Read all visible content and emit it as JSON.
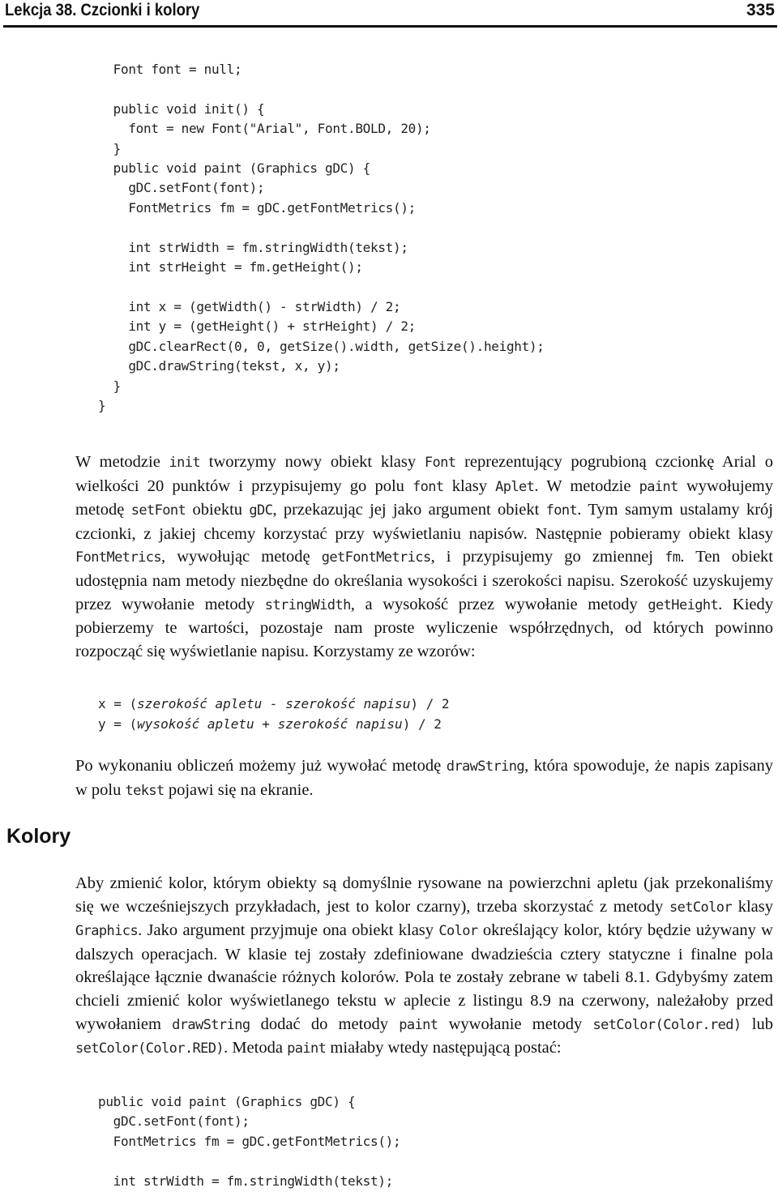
{
  "header": {
    "title": "Lekcja 38. Czcionki i kolory",
    "page_number": "335"
  },
  "code1": [
    "  Font font = null;",
    "",
    "  public void init() {",
    "    font = new Font(\"Arial\", Font.BOLD, 20);",
    "  }",
    "  public void paint (Graphics gDC) {",
    "    gDC.setFont(font);",
    "    FontMetrics fm = gDC.getFontMetrics();",
    "",
    "    int strWidth = fm.stringWidth(tekst);",
    "    int strHeight = fm.getHeight();",
    "",
    "    int x = (getWidth() - strWidth) / 2;",
    "    int y = (getHeight() + strHeight) / 2;",
    "    gDC.clearRect(0, 0, getSize().width, getSize().height);",
    "    gDC.drawString(tekst, x, y);",
    "  }",
    "}"
  ],
  "para1": [
    {
      "t": "W metodzie "
    },
    {
      "c": "init"
    },
    {
      "t": " tworzymy nowy obiekt klasy "
    },
    {
      "c": "Font"
    },
    {
      "t": " reprezentujący pogrubioną czcionkę Arial o wielkości 20 punktów i przypisujemy go polu "
    },
    {
      "c": "font"
    },
    {
      "t": " klasy "
    },
    {
      "c": "Aplet"
    },
    {
      "t": ". W metodzie "
    },
    {
      "c": "paint"
    },
    {
      "t": " wywołujemy metodę "
    },
    {
      "c": "setFont"
    },
    {
      "t": " obiektu "
    },
    {
      "c": "gDC"
    },
    {
      "t": ", przekazując jej jako argument obiekt "
    },
    {
      "c": "font"
    },
    {
      "t": ". Tym samym ustalamy krój czcionki, z jakiej chcemy korzystać przy wyświetlaniu napisów. Następnie pobieramy obiekt klasy "
    },
    {
      "c": "FontMetrics"
    },
    {
      "t": ", wywołując metodę "
    },
    {
      "c": "getFontMetrics"
    },
    {
      "t": ", i przypisujemy go zmiennej "
    },
    {
      "c": "fm"
    },
    {
      "t": ". Ten obiekt udostępnia nam metody niezbędne do określania wysokości i szerokości napisu. Szerokość uzyskujemy przez wywołanie metody "
    },
    {
      "c": "stringWidth"
    },
    {
      "t": ", a wysokość przez wywołanie metody "
    },
    {
      "c": "getHeight"
    },
    {
      "t": ". Kiedy pobierzemy te wartości, pozostaje nam proste wyliczenie współrzędnych, od których powinno rozpocząć się wyświetlanie napisu. Korzystamy ze wzorów:"
    }
  ],
  "formulas": [
    {
      "lhs": "x = (",
      "expr": "szerokość apletu - szerokość napisu",
      "rhs": ") / 2"
    },
    {
      "lhs": "y = (",
      "expr": "wysokość apletu + szerokość napisu",
      "rhs": ") / 2"
    }
  ],
  "para2": [
    {
      "t": "Po wykonaniu obliczeń możemy już wywołać metodę "
    },
    {
      "c": "drawString"
    },
    {
      "t": ", która spowoduje, że napis zapisany w polu "
    },
    {
      "c": "tekst"
    },
    {
      "t": " pojawi się na ekranie."
    }
  ],
  "section_heading": "Kolory",
  "para3": [
    {
      "t": "Aby zmienić kolor, którym obiekty są domyślnie rysowane na powierzchni apletu (jak przekonaliśmy się we wcześniejszych przykładach, jest to kolor czarny), trzeba skorzystać z metody "
    },
    {
      "c": "setColor"
    },
    {
      "t": " klasy "
    },
    {
      "c": "Graphics"
    },
    {
      "t": ". Jako argument przyjmuje ona obiekt klasy "
    },
    {
      "c": "Color"
    },
    {
      "t": " określający kolor, który będzie używany w dalszych operacjach. W klasie tej zostały zdefiniowane dwadzieścia cztery statyczne i finalne pola określające łącznie dwanaście różnych kolorów. Pola te zostały zebrane w tabeli 8.1. Gdybyśmy zatem chcieli zmienić kolor wyświetlanego tekstu w aplecie z listingu 8.9 na czerwony, należałoby przed wywołaniem "
    },
    {
      "c": "drawString"
    },
    {
      "t": " dodać do metody "
    },
    {
      "c": "paint"
    },
    {
      "t": " wywołanie metody "
    },
    {
      "c": "setColor(Color.red)"
    },
    {
      "t": " lub "
    },
    {
      "c": "setColor(Color.RED)"
    },
    {
      "t": ". Metoda "
    },
    {
      "c": "paint"
    },
    {
      "t": " miałaby wtedy następującą postać:"
    }
  ],
  "code2": [
    "public void paint (Graphics gDC) {",
    "  gDC.setFont(font);",
    "  FontMetrics fm = gDC.getFontMetrics();",
    "",
    "  int strWidth = fm.stringWidth(tekst);"
  ]
}
